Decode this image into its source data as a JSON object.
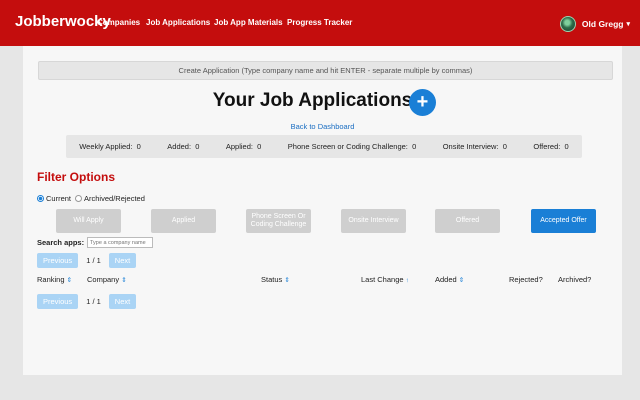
{
  "navbar": {
    "brand": "Jobberwocky",
    "links": [
      "Companies",
      "Job Applications",
      "Job App Materials",
      "Progress Tracker"
    ],
    "user_name": "Old Gregg",
    "user_caret": "▾"
  },
  "create_bar": {
    "placeholder": "Create Application (Type company name and hit ENTER - separate multiple by commas)"
  },
  "header": {
    "title": "Your Job Applications",
    "add_symbol": "+",
    "back_link": "Back to Dashboard"
  },
  "stats": [
    {
      "label": "Weekly Applied:",
      "value": "0"
    },
    {
      "label": "Added:",
      "value": "0"
    },
    {
      "label": "Applied:",
      "value": "0"
    },
    {
      "label": "Phone Screen or Coding Challenge:",
      "value": "0"
    },
    {
      "label": "Onsite Interview:",
      "value": "0"
    },
    {
      "label": "Offered:",
      "value": "0"
    }
  ],
  "filters": {
    "title": "Filter Options",
    "radio_current": "Current",
    "radio_archived": "Archived/Rejected",
    "buttons": [
      "Will Apply",
      "Applied",
      "Phone Screen Or Coding Challenge",
      "Onsite Interview",
      "Offered",
      "Accepted Offer"
    ]
  },
  "search": {
    "label": "Search apps:",
    "placeholder": "Type a company name"
  },
  "pagination": {
    "previous": "Previous",
    "page_info": "1 / 1",
    "next": "Next"
  },
  "table": {
    "headers": [
      "Ranking",
      "Company",
      "Status",
      "Last Change",
      "Added",
      "Rejected?",
      "Archived?"
    ],
    "sort_both": "⇕",
    "sort_up": "↑"
  },
  "colors": {
    "brand_red": "#c40d0d",
    "accent_blue": "#1a7fd6"
  }
}
